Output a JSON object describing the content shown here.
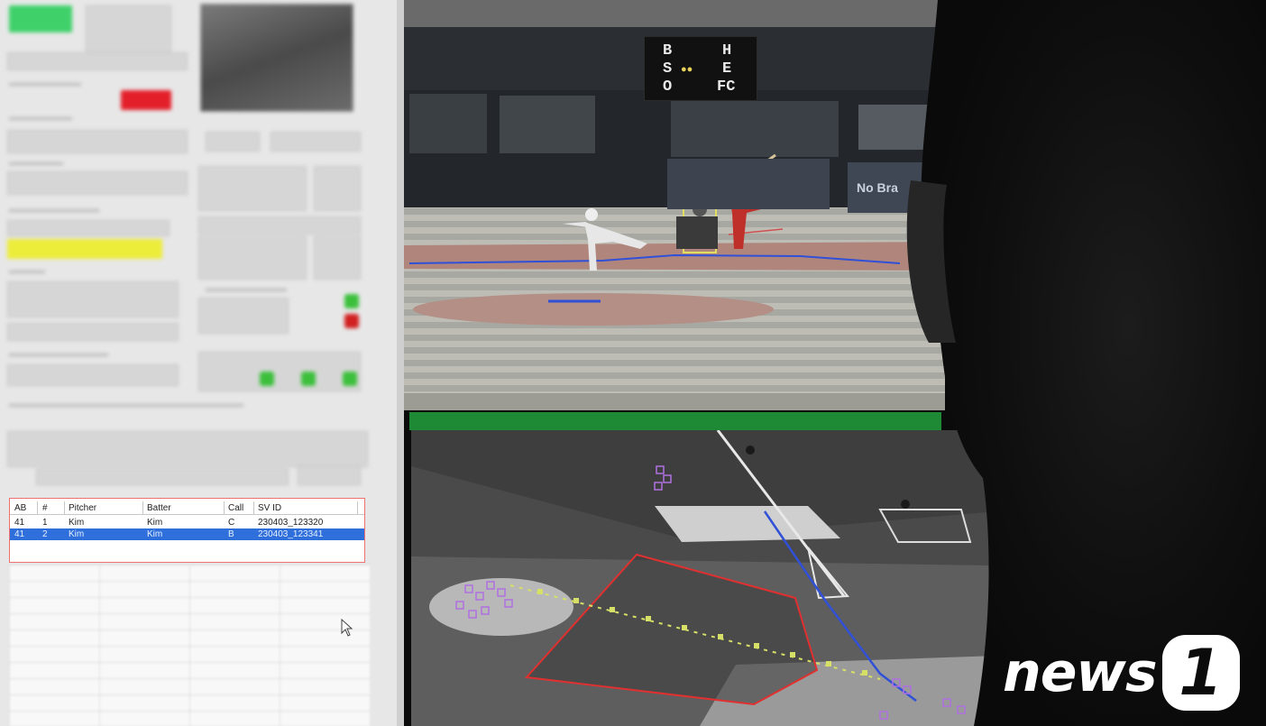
{
  "scoreboard": {
    "ball_label": "B",
    "strike_label": "S",
    "out_label": "O",
    "hit_label": "H",
    "error_label": "E",
    "fc_label": "FC"
  },
  "ad_board": {
    "text": "No Bra"
  },
  "pitch_log": {
    "columns": [
      "AB",
      "#",
      "Pitcher",
      "Batter",
      "Call",
      "SV ID"
    ],
    "rows": [
      {
        "ab": "41",
        "num": "1",
        "pitcher": "Kim",
        "batter": "Kim",
        "call": "C",
        "sv_id": "230403_123320",
        "selected": false
      },
      {
        "ab": "41",
        "num": "2",
        "pitcher": "Kim",
        "batter": "Kim",
        "call": "B",
        "sv_id": "230403_123341",
        "selected": true
      }
    ]
  },
  "watermark": {
    "text": "news",
    "badge": "1"
  },
  "colors": {
    "selection": "#2f6fdc",
    "status_green": "#3fd06a",
    "status_red": "#e3202a",
    "highlight_yellow": "#ecec3a",
    "strike_zone": "#e0e060",
    "trajectory": "#3050d8",
    "field_zone": "#d02828"
  },
  "icons": {
    "cursor": "mouse-pointer-icon"
  }
}
